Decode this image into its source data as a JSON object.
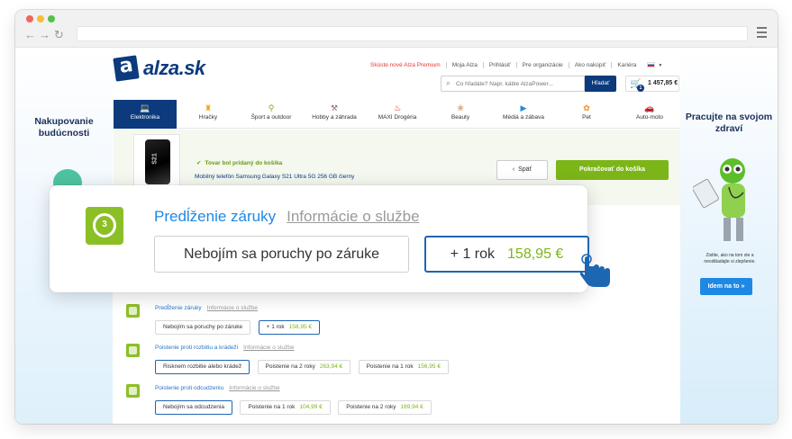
{
  "header": {
    "top_links": [
      "Skúste nové Alza Premium",
      "Moja Alza",
      "Prihlásiť",
      "Pre organizácie",
      "Ako nakúpiť",
      "Kariéra"
    ],
    "logo_text": "alza.sk",
    "search": {
      "placeholder": "Čo hľadáte? Napr. káble AlzaPower...",
      "button": "Hľadať"
    },
    "cart": {
      "count": "1",
      "total": "1 457,85 €"
    }
  },
  "nav": {
    "items": [
      {
        "label": "Elektronika",
        "icon": "laptop-icon"
      },
      {
        "label": "Hračky",
        "icon": "toy-icon"
      },
      {
        "label": "Šport a outdoor",
        "icon": "bike-icon"
      },
      {
        "label": "Hobby a záhrada",
        "icon": "hammer-icon"
      },
      {
        "label": "MAXI Drogéria",
        "icon": "spray-icon"
      },
      {
        "label": "Beauty",
        "icon": "beauty-icon"
      },
      {
        "label": "Médiá a zábava",
        "icon": "play-icon"
      },
      {
        "label": "Pet",
        "icon": "paw-icon"
      },
      {
        "label": "Auto-moto",
        "icon": "car-icon"
      }
    ],
    "active_index": 0
  },
  "added": {
    "message": "Tovar bol pridaný do košíka",
    "product": "Mobilný telefón Samsung Galaxy S21 Ultra 5G 256 GB čierny",
    "back_label": "Späť",
    "continue_label": "Pokračovať do košíka"
  },
  "side_left": {
    "title": "Nakupovanie budúcnosti"
  },
  "side_right": {
    "title": "Pracujte na svojom zdraví",
    "note": "Zistite, ako na tom ste a neodkladajte si zlepšenie.",
    "button": "Idem na to »"
  },
  "callout": {
    "icon_number": "3",
    "tab_active": "Predĺženie záruky",
    "tab_info": "Informácie o službe",
    "option_1": "Nebojím sa poruchy po záruke",
    "option_2_label": "+ 1 rok",
    "option_2_price": "158,95 €"
  },
  "services": [
    {
      "title": "Predĺženie záruky",
      "info": "Informácie o službe",
      "options": [
        {
          "label": "Nebojím sa poruchy po záruke",
          "price": ""
        },
        {
          "label": "+ 1 rok",
          "price": "158,95 €",
          "selected": true
        }
      ]
    },
    {
      "title": "Poistenie proti rozbitiu a krádeži",
      "info": "Informácie o službe",
      "options": [
        {
          "label": "Risknem rozbitie alebo krádež",
          "price": "",
          "selected": true
        },
        {
          "label": "Poistenie na 2 roky",
          "price": "263,94 €"
        },
        {
          "label": "Poistenie na 1 rok",
          "price": "156,95 €"
        }
      ]
    },
    {
      "title": "Poistenie proti odcudzeniu",
      "info": "Informácie o službe",
      "options": [
        {
          "label": "Nebojím sa odcudzenia",
          "price": "",
          "selected": true
        },
        {
          "label": "Poistenie na 1 rok",
          "price": "104,99 €"
        },
        {
          "label": "Poistenie na 2 roky",
          "price": "169,94 €"
        }
      ]
    }
  ]
}
